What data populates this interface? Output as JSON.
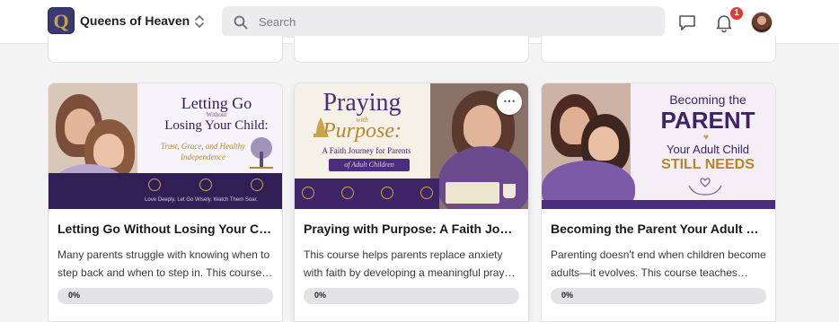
{
  "header": {
    "brand_initial": "Q",
    "brand_name": "Queens of Heaven",
    "search_placeholder": "Search",
    "notification_count": "1"
  },
  "colors": {
    "accent_purple": "#4b2d7f",
    "badge_red": "#e53935",
    "gold": "#c9a44a"
  },
  "courses": [
    {
      "title": "Letting Go Without Losing Your Child",
      "description": "Many parents struggle with knowing when to step back and when to step in. This course helps parents navigate this stage with trust and grace.",
      "progress_percent": 0,
      "progress_label": "0%",
      "thumb_title_line1": "Letting Go",
      "thumb_title_small": "Without",
      "thumb_title_line2": "Losing Your Child:",
      "thumb_subtitle": "Trust, Grace, and Healthy Independence",
      "thumb_footer": "Love Deeply. Let Go Wisely. Watch Them Soar."
    },
    {
      "title": "Praying with Purpose: A Faith Journey for Parents of Adult Children",
      "description": "This course helps parents replace anxiety with faith by developing a meaningful prayer life for their adult children.",
      "progress_percent": 0,
      "progress_label": "0%",
      "thumb_title_line1": "Praying",
      "thumb_title_small": "with",
      "thumb_title_line2": "Purpose:",
      "thumb_subtitle": "A Faith Journey for Parents",
      "thumb_footer": "of Adult Children"
    },
    {
      "title": "Becoming the Parent Your Adult Child Still Needs",
      "description": "Parenting doesn't end when children become adults—it evolves. This course teaches parents how to grow into this new role.",
      "progress_percent": 0,
      "progress_label": "0%",
      "thumb_title_line1": "Becoming the",
      "thumb_title_line2": "PARENT",
      "thumb_subtitle": "Your Adult Child",
      "thumb_footer": "STILL NEEDS"
    }
  ]
}
